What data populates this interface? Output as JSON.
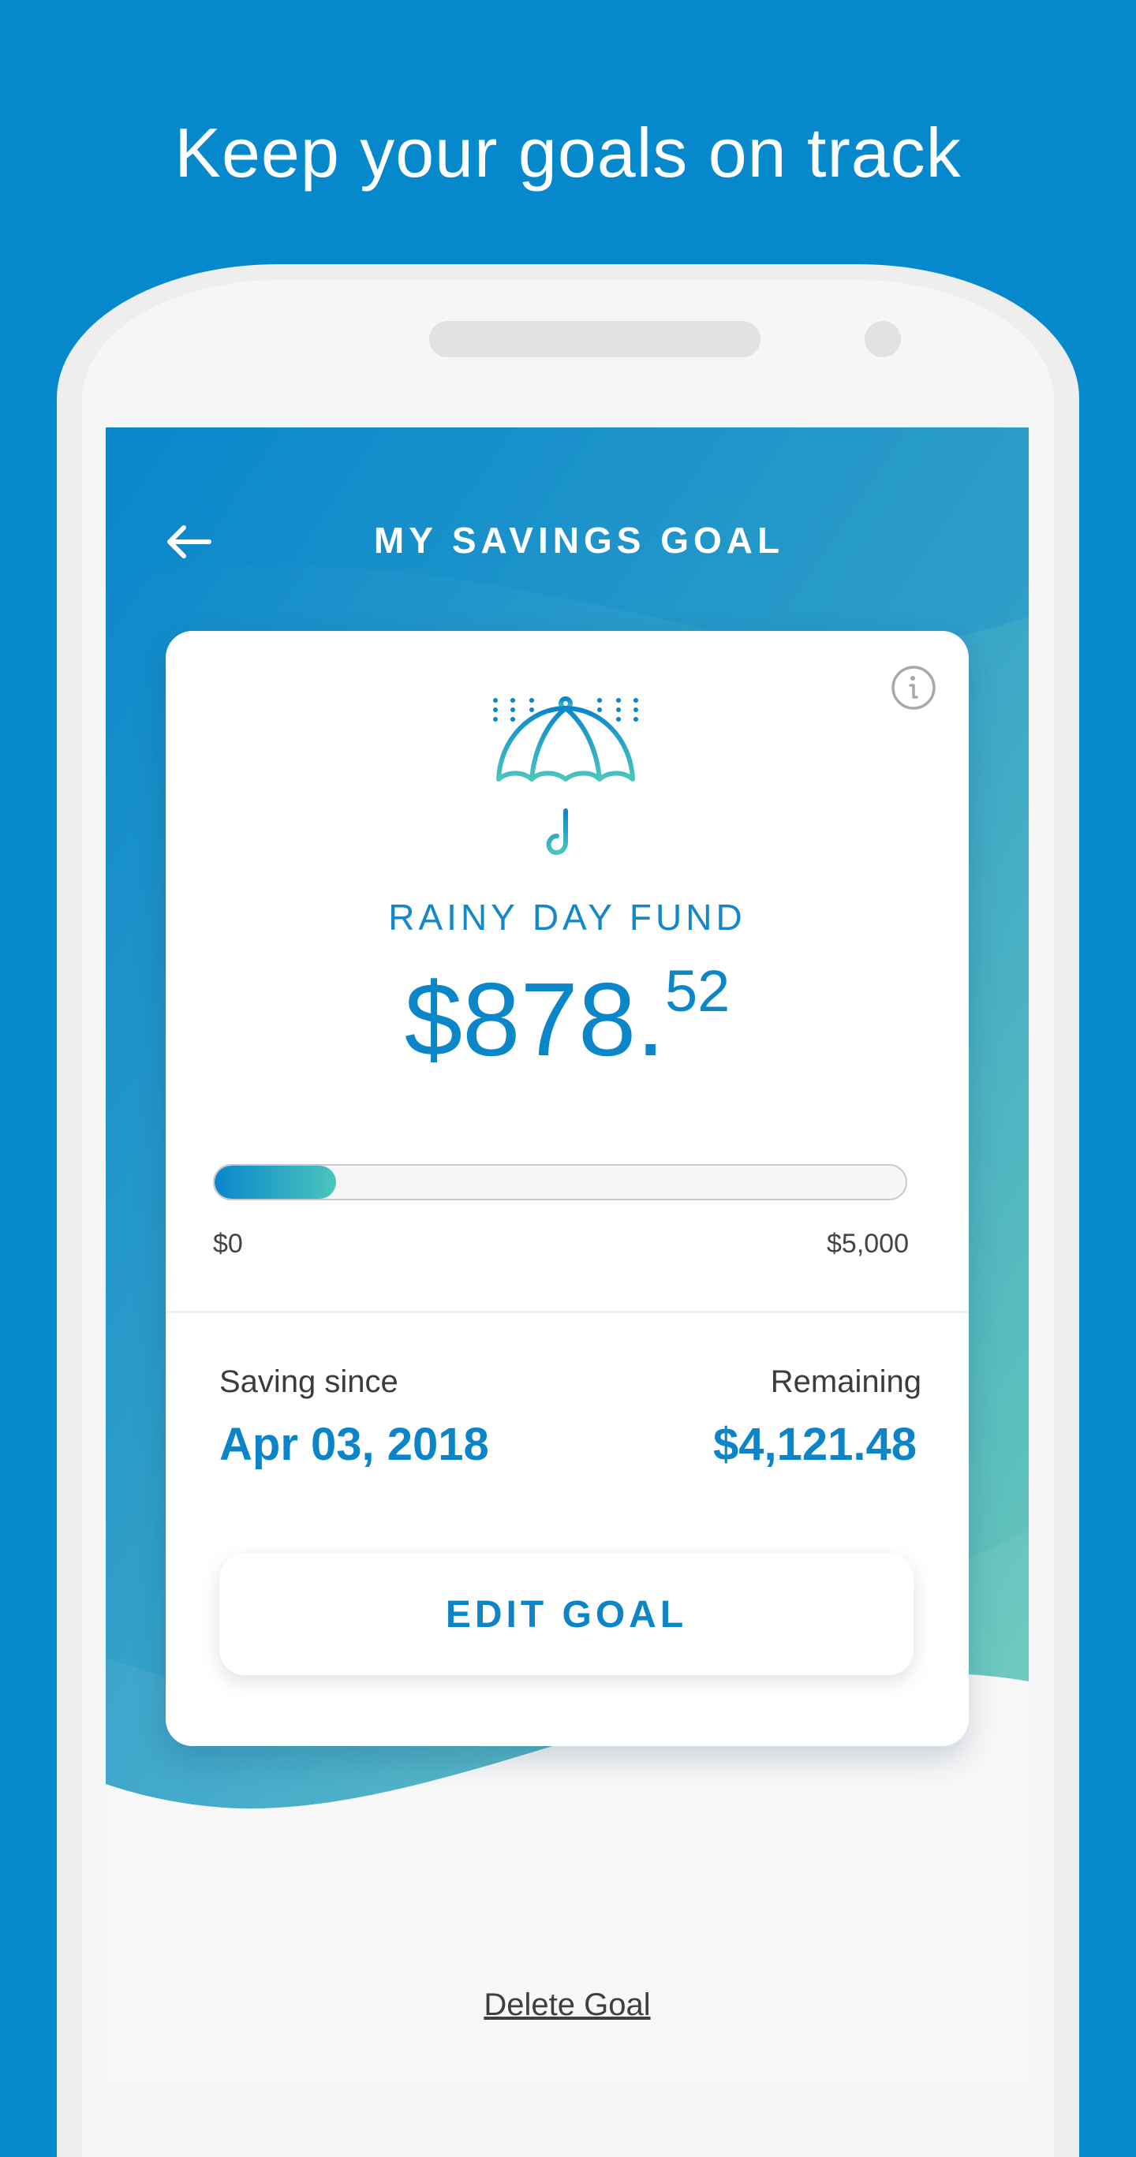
{
  "promo": {
    "title": "Keep your goals on track"
  },
  "nav": {
    "back_icon": "arrow-left-icon",
    "title": "MY SAVINGS GOAL"
  },
  "card": {
    "info_icon": "info-icon",
    "goal_icon": "umbrella-rain-icon",
    "goal_name": "RAINY DAY FUND",
    "amount_main": "$878.",
    "amount_cents": "52",
    "progress_fraction": 0.1757,
    "range_min": "$0",
    "range_max": "$5,000",
    "saving_since_label": "Saving since",
    "saving_since_value": "Apr 03, 2018",
    "remaining_label": "Remaining",
    "remaining_value": "$4,121.48",
    "edit_label": "EDIT GOAL"
  },
  "delete_label": "Delete Goal",
  "colors": {
    "background": "#0688cc",
    "accent": "#0b84c8",
    "teal": "#4ac5bd",
    "screen_bg": "#f8f8f8"
  }
}
